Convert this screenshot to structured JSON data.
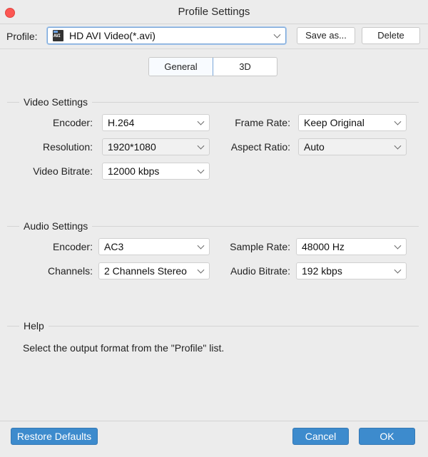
{
  "window": {
    "title": "Profile Settings",
    "close_icon": "close-dot"
  },
  "profile": {
    "label": "Profile:",
    "value": "HD AVI Video(*.avi)",
    "icon": "avi-file-icon",
    "icon_text": "AVI",
    "save_as_label": "Save as...",
    "delete_label": "Delete"
  },
  "tabs": [
    {
      "label": "General",
      "active": true
    },
    {
      "label": "3D",
      "active": false
    }
  ],
  "video": {
    "title": "Video Settings",
    "encoder": {
      "label": "Encoder:",
      "value": "H.264"
    },
    "frame_rate": {
      "label": "Frame Rate:",
      "value": "Keep Original"
    },
    "resolution": {
      "label": "Resolution:",
      "value": "1920*1080",
      "disabled": true
    },
    "aspect_ratio": {
      "label": "Aspect Ratio:",
      "value": "Auto",
      "disabled": true
    },
    "bitrate": {
      "label": "Video Bitrate:",
      "value": "12000 kbps"
    }
  },
  "audio": {
    "title": "Audio Settings",
    "encoder": {
      "label": "Encoder:",
      "value": "AC3"
    },
    "sample_rate": {
      "label": "Sample Rate:",
      "value": "48000 Hz"
    },
    "channels": {
      "label": "Channels:",
      "value": "2 Channels Stereo"
    },
    "bitrate": {
      "label": "Audio Bitrate:",
      "value": "192 kbps"
    }
  },
  "help": {
    "title": "Help",
    "text": "Select the output format from the \"Profile\" list."
  },
  "footer": {
    "restore_label": "Restore Defaults",
    "cancel_label": "Cancel",
    "ok_label": "OK"
  },
  "colors": {
    "accent_button": "#3d8bcd",
    "focus_border": "#7aa7d8",
    "close_button": "#fc5753",
    "background": "#ececec"
  }
}
